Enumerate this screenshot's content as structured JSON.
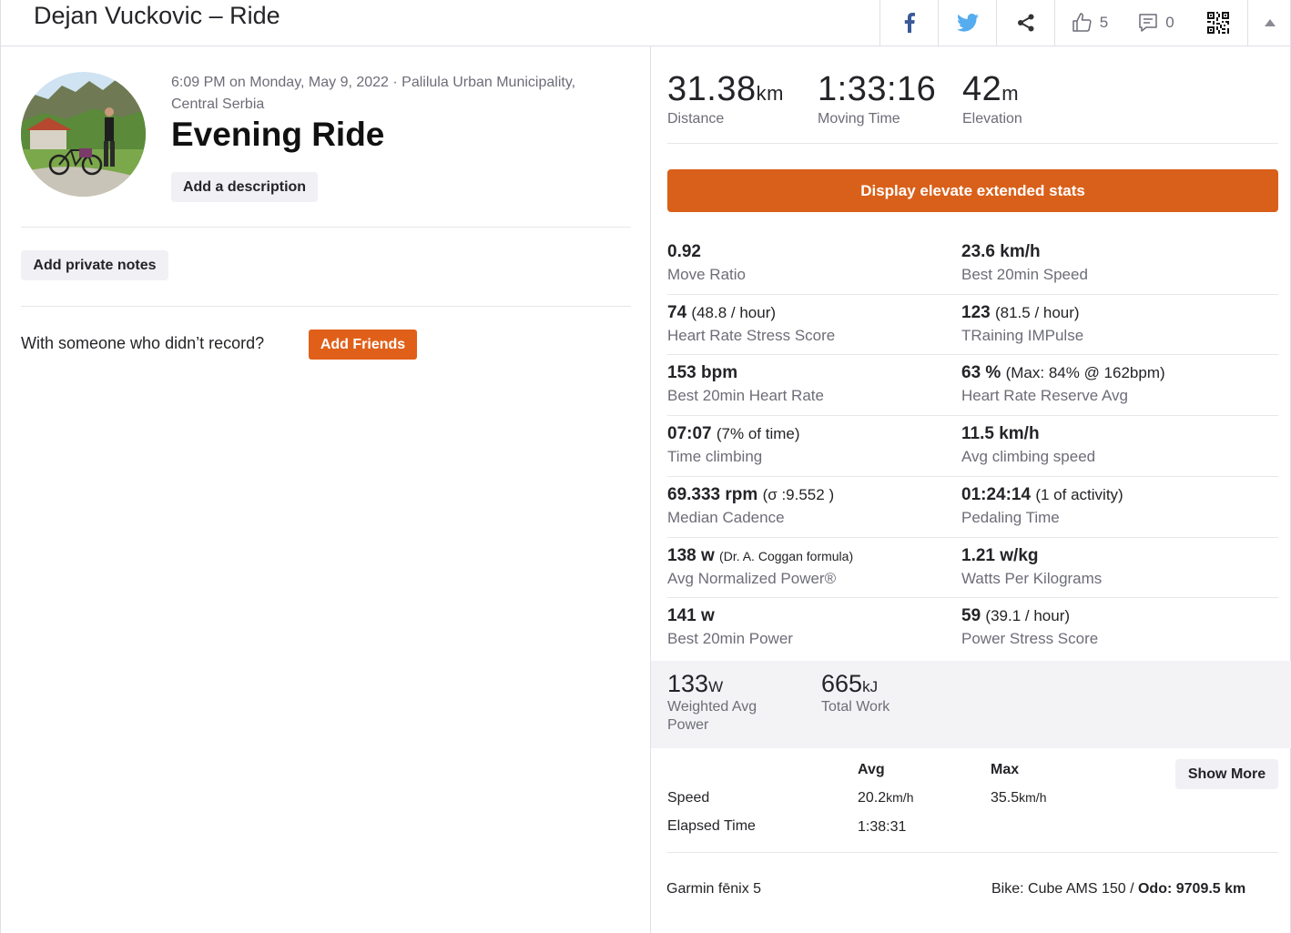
{
  "header": {
    "title": "Dejan Vuckovic – Ride",
    "kudos_count": "5",
    "comments_count": "0"
  },
  "activity": {
    "meta": "6:09 PM on Monday, May 9, 2022 · Palilula Urban Municipality, Central Serbia",
    "title": "Evening Ride",
    "add_description": "Add a description",
    "add_private_notes": "Add private notes",
    "with_someone": "With someone who didn’t record?",
    "add_friends": "Add Friends"
  },
  "primary_stats": [
    {
      "value": "31.38",
      "unit": "km",
      "label": "Distance"
    },
    {
      "value": "1:33:16",
      "unit": "",
      "label": "Moving Time"
    },
    {
      "value": "42",
      "unit": "m",
      "label": "Elevation"
    }
  ],
  "elevate_button": "Display elevate extended stats",
  "extended_stats": [
    {
      "value": "0.92",
      "extra": "",
      "label": "Move Ratio"
    },
    {
      "value": "23.6 km/h",
      "extra": "",
      "label": "Best 20min Speed"
    },
    {
      "value": "74",
      "extra": "(48.8 / hour)",
      "label": "Heart Rate Stress Score"
    },
    {
      "value": "123",
      "extra": "(81.5 / hour)",
      "label": "TRaining IMPulse"
    },
    {
      "value": "153 bpm",
      "extra": "",
      "label": "Best 20min Heart Rate"
    },
    {
      "value": "63 %",
      "extra": "(Max: 84% @ 162bpm)",
      "label": "Heart Rate Reserve Avg"
    },
    {
      "value": "07:07",
      "extra": "(7% of time)",
      "label": "Time climbing"
    },
    {
      "value": "11.5 km/h",
      "extra": "",
      "label": "Avg climbing speed"
    },
    {
      "value": "69.333 rpm",
      "extra": "(σ :9.552 )",
      "label": "Median Cadence"
    },
    {
      "value": "01:24:14",
      "extra": "(1 of activity)",
      "label": "Pedaling Time"
    },
    {
      "value": "138 w",
      "extra": "(Dr. A. Coggan formula)",
      "label": "Avg Normalized Power®"
    },
    {
      "value": "1.21 w/kg",
      "extra": "",
      "label": "Watts Per Kilograms"
    },
    {
      "value": "141 w",
      "extra": "",
      "label": "Best 20min Power"
    },
    {
      "value": "59",
      "extra": "(39.1 / hour)",
      "label": "Power Stress Score"
    }
  ],
  "power_stats": [
    {
      "value": "133",
      "unit": "W",
      "label_line1": "Weighted Avg",
      "label_line2": "Power"
    },
    {
      "value": "665",
      "unit": "kJ",
      "label_line1": "Total Work",
      "label_line2": ""
    }
  ],
  "table": {
    "col_avg": "Avg",
    "col_max": "Max",
    "show_more": "Show More",
    "rows": [
      {
        "label": "Speed",
        "avg": "20.2",
        "avg_unit": "km/h",
        "max": "35.5",
        "max_unit": "km/h"
      },
      {
        "label": "Elapsed Time",
        "avg": "1:38:31",
        "avg_unit": "",
        "max": "",
        "max_unit": ""
      }
    ]
  },
  "footer": {
    "device": "Garmin fēnix 5",
    "bike_prefix": "Bike: Cube AMS 150 / ",
    "odo_label": "Odo:",
    "odo_value": " 9709.5 km"
  },
  "colors": {
    "accent": "#e0601a",
    "elevate": "#d9601a",
    "text": "#242428",
    "muted": "#6d6d78"
  }
}
